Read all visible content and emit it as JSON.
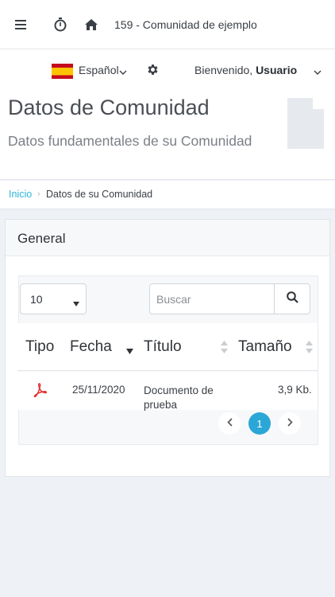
{
  "topbar": {
    "community": "159 - Comunidad de ejemplo"
  },
  "subbar": {
    "language": "Español",
    "welcome_prefix": "Bienvenido, ",
    "user_name": "Usuario"
  },
  "page": {
    "title": "Datos de Comunidad",
    "subtitle": "Datos fundamentales de su Comunidad"
  },
  "breadcrumb": {
    "home": "Inicio",
    "separator": "›",
    "current": "Datos de su Comunidad"
  },
  "card": {
    "title": "General",
    "page_size": "10",
    "search_placeholder": "Buscar",
    "columns": {
      "tipo": "Tipo",
      "fecha": "Fecha",
      "titulo": "Título",
      "tamano": "Tamaño"
    },
    "rows": [
      {
        "icon": "pdf-icon",
        "fecha": "25/11/2020",
        "titulo": "Documento de prueba",
        "tamano": "3,9 Kb."
      }
    ],
    "pagination": {
      "current": "1"
    }
  },
  "colors": {
    "accent": "#2aa7d6",
    "link": "#2ab6d9",
    "pdf": "#e3302f"
  }
}
